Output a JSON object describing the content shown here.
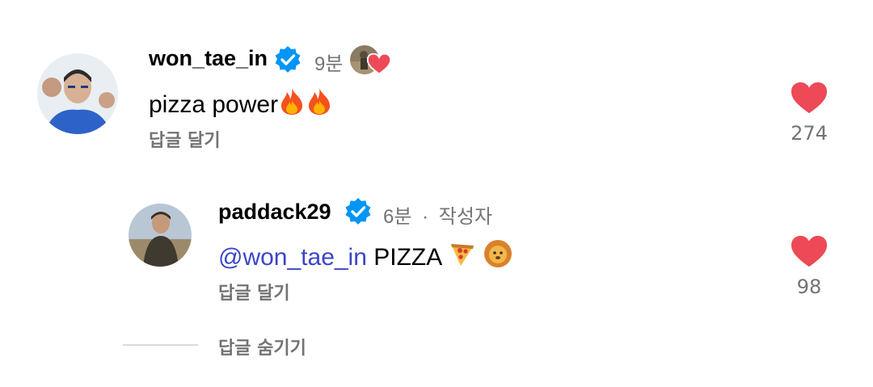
{
  "comments": [
    {
      "username": "won_tae_in",
      "verified": true,
      "time": "9분",
      "author_like_icon": "author-avatar-with-heart-icon",
      "text": "pizza power",
      "emojis": [
        "fire-emoji",
        "fire-emoji"
      ],
      "reply_label": "답글 달기",
      "like_count": "274"
    },
    {
      "username": "paddack29",
      "verified": true,
      "time": "6분",
      "separator": "·",
      "author_tag": "작성자",
      "mention": "@won_tae_in",
      "text": "PIZZA",
      "emojis": [
        "pizza-emoji",
        "lion-emoji"
      ],
      "reply_label": "답글 달기",
      "like_count": "98"
    }
  ],
  "hide_replies_label": "답글 숨기기",
  "colors": {
    "heart": "#ed4956",
    "verified": "#0095f6",
    "mention": "#3b45c8",
    "muted": "#737373"
  }
}
